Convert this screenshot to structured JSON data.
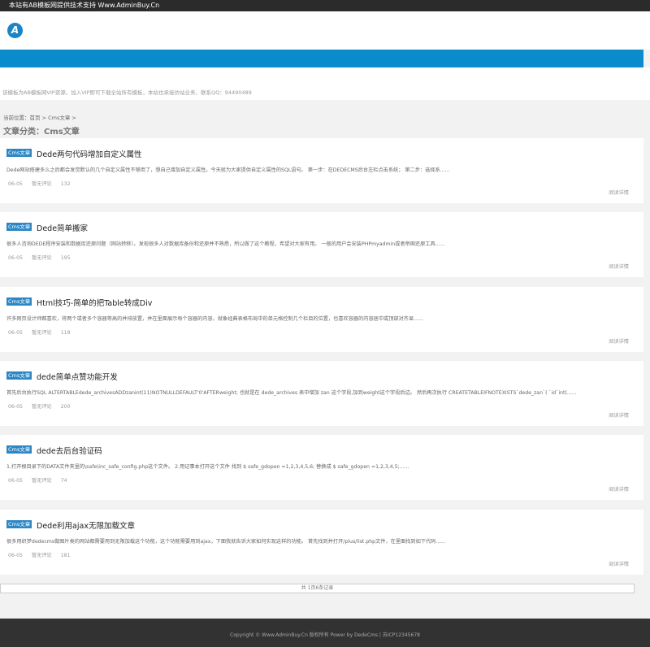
{
  "topbar": {
    "text": "本站有AB模板网提供技术支持 Www.AdminBuy.Cn"
  },
  "header": {
    "logo_letter": "A"
  },
  "notice": {
    "text": "该模板为AB模板网VIP资源，加入VIP即可下载全站所有模板，本站也承接仿站业务，联系QQ：94490489"
  },
  "breadcrumb": {
    "prefix": "当前位置：",
    "home": "首页",
    "sep1": " > ",
    "category": "Cms文章",
    "sep2": " >"
  },
  "category_title": "文章分类：Cms文章",
  "articles": [
    {
      "tag": "Cms文章",
      "title": "Dede两句代码增加自定义属性",
      "desc": "Dede网站搭建多么之后都会发觉默认的几个自定义属性不够用了，想自己增加自定义属性。今天就为大家提供自定义属性的SQL语句。 第一步：在DEDECMS后台左栏点击系统； 第二步：选择系......",
      "date": "06-05",
      "comments": "暂无评论",
      "views": "132",
      "more": "阅读详情"
    },
    {
      "tag": "Cms文章",
      "title": "Dede简单搬家",
      "desc": "很多人咨询DEDE程序安装和数据库还原问题（网站转移）。发现很多人对数据库备份和还原并不熟悉，所以做了这个教程，希望对大家有用。 一般的用户会安装PHPmyadmin或者帝国还原工具......",
      "date": "06-05",
      "comments": "暂无评论",
      "views": "195",
      "more": "阅读详情"
    },
    {
      "tag": "Cms文章",
      "title": "Html技巧-简单的把Table转成Div",
      "desc": "许多网页设计师都喜欢，将两个或者多个容器等高的并排放置，并在里面展示每个容器的内容，就象经典表格布局中的单元格控制几个栏目的位置，也喜欢容器的内容居中或顶部对齐显......",
      "date": "06-05",
      "comments": "暂无评论",
      "views": "118",
      "more": "阅读详情"
    },
    {
      "tag": "Cms文章",
      "title": "dede简单点赞功能开发",
      "desc": "首先后台执行SQL ALTERTABLEdede_archivesADDzanint(11)NOTNULLDEFAULT'0'AFTERweight; 也就是在 dede_archives 表中增加 zan 这个字段,加到weight这个字段后边。 然后再次执行 CREATETABLEIFNOTEXISTS`dede_zan`( `id`int(......",
      "date": "06-05",
      "comments": "暂无评论",
      "views": "200",
      "more": "阅读详情"
    },
    {
      "tag": "Cms文章",
      "title": "dede去后台验证码",
      "desc": "1.打开根目录下的DATA文件夹里的\\safe\\inc_safe_config.php这个文件。 2.用记事本打开这个文件 找到 $ safe_gdopen =1,2,3,4,5,6; 替换成 $ safe_gdopen =1,2,3,4,5;......",
      "date": "06-05",
      "comments": "暂无评论",
      "views": "74",
      "more": "阅读详情"
    },
    {
      "tag": "Cms文章",
      "title": "Dede利用ajax无限加载文章",
      "desc": "很多用织梦dedecms做图片类的网站都需要用到无限加载这个功能，这个功能需要用到ajax，下面我就告诉大家如何实现这样的功能。 首先找到并打开/plus/list.php文件，在里面找到如下代码......",
      "date": "06-05",
      "comments": "暂无评论",
      "views": "181",
      "more": "阅读详情"
    }
  ],
  "pager": {
    "text": "共 1页6条记录"
  },
  "footer": {
    "text": "Copyright © Www.AdminBuy.Cn 版权所有 Power by DedeCms | 苏ICP12345678"
  },
  "colors": {
    "accent": "#0a8bcc",
    "tag": "#2c87c4",
    "footer_bg": "#323232",
    "topbar_bg": "#2b2b2b"
  },
  "icons": {
    "logo": "logo-icon"
  }
}
